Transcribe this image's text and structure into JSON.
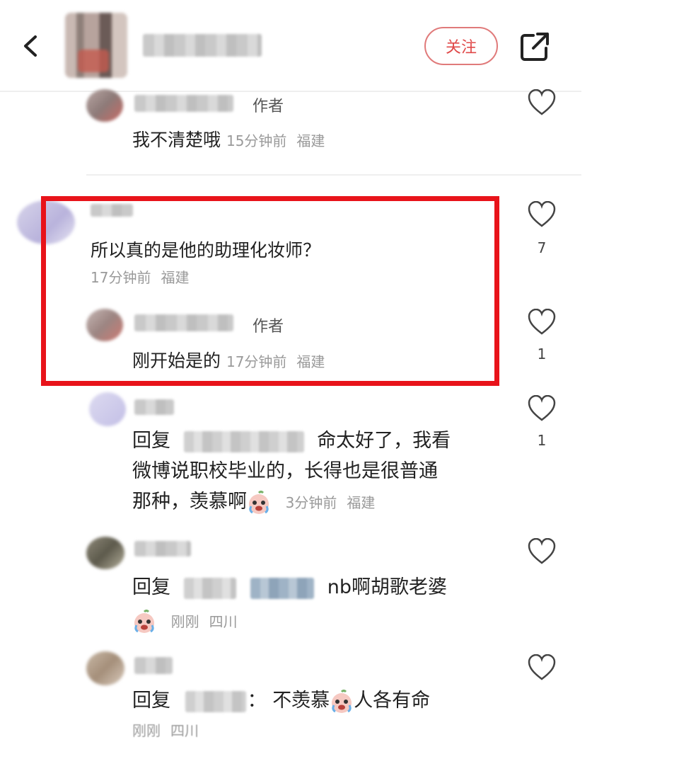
{
  "header": {
    "follow_label": "关注"
  },
  "comments": [
    {
      "author_tag": "作者",
      "text": "我不清楚哦",
      "time": "15分钟前",
      "location": "福建"
    },
    {
      "text": "所以真的是他的助理化妆师？",
      "time": "17分钟前",
      "location": "福建",
      "likes": "7"
    },
    {
      "author_tag": "作者",
      "text": "刚开始是的",
      "time": "17分钟前",
      "location": "福建",
      "likes": "1"
    },
    {
      "reply_prefix": "回复",
      "line1": "命太好了，我看",
      "line2": "微博说职校毕业的，长得也是很普通",
      "line3": "那种，羡慕啊",
      "time": "3分钟前",
      "location": "福建",
      "likes": "1"
    },
    {
      "reply_prefix": "回复",
      "text": "nb啊胡歌老婆",
      "time": "刚刚",
      "location": "四川"
    },
    {
      "reply_prefix": "回复",
      "colon": "：",
      "text_a": "不羡慕",
      "text_b": "人各有命",
      "time": "刚刚",
      "location": "四川"
    }
  ],
  "colors": {
    "highlight_border": "#e8131a",
    "follow_accent": "#e04a4a"
  },
  "icons": [
    "back-icon",
    "share-icon",
    "heart-icon",
    "crying-emoji"
  ]
}
